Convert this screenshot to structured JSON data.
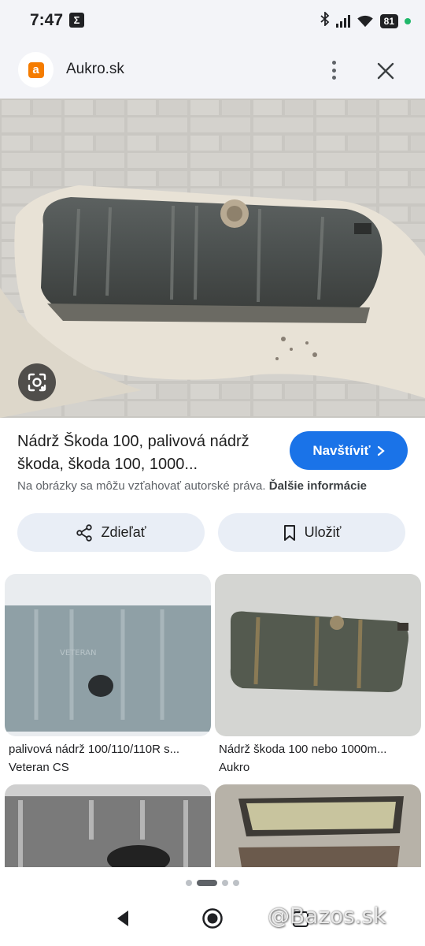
{
  "status_bar": {
    "time": "7:47",
    "battery": "81"
  },
  "source_header": {
    "logo_letter": "a",
    "site_name": "Aukro.sk"
  },
  "result": {
    "title": "Nádrž Škoda 100, palivová nádrž škoda, škoda 100, 1000...",
    "visit_label": "Navštíviť",
    "copyright_text": "Na obrázky sa môžu vzťahovať autorské práva.",
    "more_info_label": "Ďalšie informácie"
  },
  "actions": {
    "share_label": "Zdieľať",
    "save_label": "Uložiť"
  },
  "related": [
    {
      "caption": "palivová nádrž 100/110/110R s...",
      "source": "Veteran CS"
    },
    {
      "caption": "Nádrž škoda 100 nebo 1000m...",
      "source": "Aukro"
    },
    {
      "caption": "",
      "source": ""
    },
    {
      "caption": "",
      "source": ""
    }
  ],
  "watermark": "@Bazos.sk",
  "colors": {
    "accent": "#1a73e8",
    "pill_bg": "#e9eef6",
    "header_bg": "#f3f4f8",
    "logo_orange": "#f57c00"
  }
}
